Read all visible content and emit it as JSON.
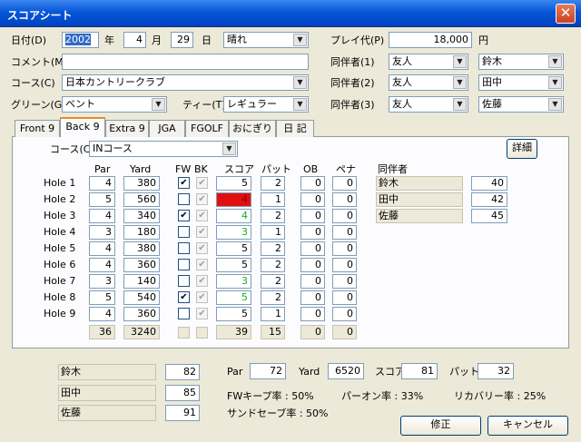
{
  "window": {
    "title": "スコアシート"
  },
  "date": {
    "label": "日付(D)",
    "year": "2002",
    "year_unit": "年",
    "month": "4",
    "month_unit": "月",
    "day": "29",
    "day_unit": "日",
    "weather": "晴れ"
  },
  "comment": {
    "label": "コメント(M)",
    "value": ""
  },
  "course": {
    "label": "コース(C)",
    "value": "日本カントリークラブ"
  },
  "green": {
    "label": "グリーン(G)",
    "value": "ベント"
  },
  "tee": {
    "label": "ティー(T)",
    "value": "レギュラー"
  },
  "fee": {
    "label": "プレイ代(P)",
    "value": "18,000",
    "unit": "円"
  },
  "companions": [
    {
      "label": "同伴者(1)",
      "relation": "友人",
      "name": "鈴木"
    },
    {
      "label": "同伴者(2)",
      "relation": "友人",
      "name": "田中"
    },
    {
      "label": "同伴者(3)",
      "relation": "友人",
      "name": "佐藤"
    }
  ],
  "tabs": [
    "Front 9",
    "Back 9",
    "Extra 9",
    "JGA",
    "FGOLF",
    "おにぎり",
    "日 記"
  ],
  "active_tab": "Back 9",
  "panel": {
    "course_label": "コース(C)",
    "course_value": "INコース",
    "detail_button": "詳細",
    "headers": {
      "par": "Par",
      "yard": "Yard",
      "fw": "FW",
      "bk": "BK",
      "score": "スコア",
      "putt": "パット",
      "ob": "OB",
      "pen": "ペナ",
      "companion": "同伴者"
    },
    "holes": [
      {
        "label": "Hole 1",
        "par": "4",
        "yard": "380",
        "fw": true,
        "score": "5",
        "putt": "2",
        "ob": "0",
        "pen": "0"
      },
      {
        "label": "Hole 2",
        "par": "5",
        "yard": "560",
        "fw": false,
        "score": "4",
        "putt": "1",
        "ob": "0",
        "pen": "0"
      },
      {
        "label": "Hole 3",
        "par": "4",
        "yard": "340",
        "fw": true,
        "score": "4",
        "putt": "2",
        "ob": "0",
        "pen": "0"
      },
      {
        "label": "Hole 4",
        "par": "3",
        "yard": "180",
        "fw": false,
        "score": "3",
        "putt": "1",
        "ob": "0",
        "pen": "0"
      },
      {
        "label": "Hole 5",
        "par": "4",
        "yard": "380",
        "fw": false,
        "score": "5",
        "putt": "2",
        "ob": "0",
        "pen": "0"
      },
      {
        "label": "Hole 6",
        "par": "4",
        "yard": "360",
        "fw": false,
        "score": "5",
        "putt": "2",
        "ob": "0",
        "pen": "0"
      },
      {
        "label": "Hole 7",
        "par": "3",
        "yard": "140",
        "fw": false,
        "score": "3",
        "putt": "2",
        "ob": "0",
        "pen": "0"
      },
      {
        "label": "Hole 8",
        "par": "5",
        "yard": "540",
        "fw": true,
        "score": "5",
        "putt": "2",
        "ob": "0",
        "pen": "0"
      },
      {
        "label": "Hole 9",
        "par": "4",
        "yard": "360",
        "fw": false,
        "score": "5",
        "putt": "1",
        "ob": "0",
        "pen": "0"
      }
    ],
    "totals": {
      "par": "36",
      "yard": "3240",
      "score": "39",
      "putt": "15",
      "ob": "0",
      "pen": "0"
    },
    "companion_scores": [
      {
        "name": "鈴木",
        "score": "40"
      },
      {
        "name": "田中",
        "score": "42"
      },
      {
        "name": "佐藤",
        "score": "45"
      }
    ]
  },
  "bottom": {
    "players": [
      {
        "name": "鈴木",
        "score": "82"
      },
      {
        "name": "田中",
        "score": "85"
      },
      {
        "name": "佐藤",
        "score": "91"
      }
    ],
    "par_label": "Par",
    "par": "72",
    "yard_label": "Yard",
    "yard": "6520",
    "score_label": "スコア",
    "score": "81",
    "putt_label": "パット",
    "putt": "32",
    "fw_keep": "FWキープ率 : 50%",
    "par_on": "パーオン率 : 33%",
    "recovery": "リカバリー率 : 25%",
    "sand_save": "サンドセーブ率 : 50%",
    "edit_button": "修正",
    "cancel_button": "キャンセル"
  },
  "colors": {
    "eagle_or_birdie_bg": "#e11010",
    "par_text": "#18b018",
    "titlebar": "#0756d8"
  }
}
